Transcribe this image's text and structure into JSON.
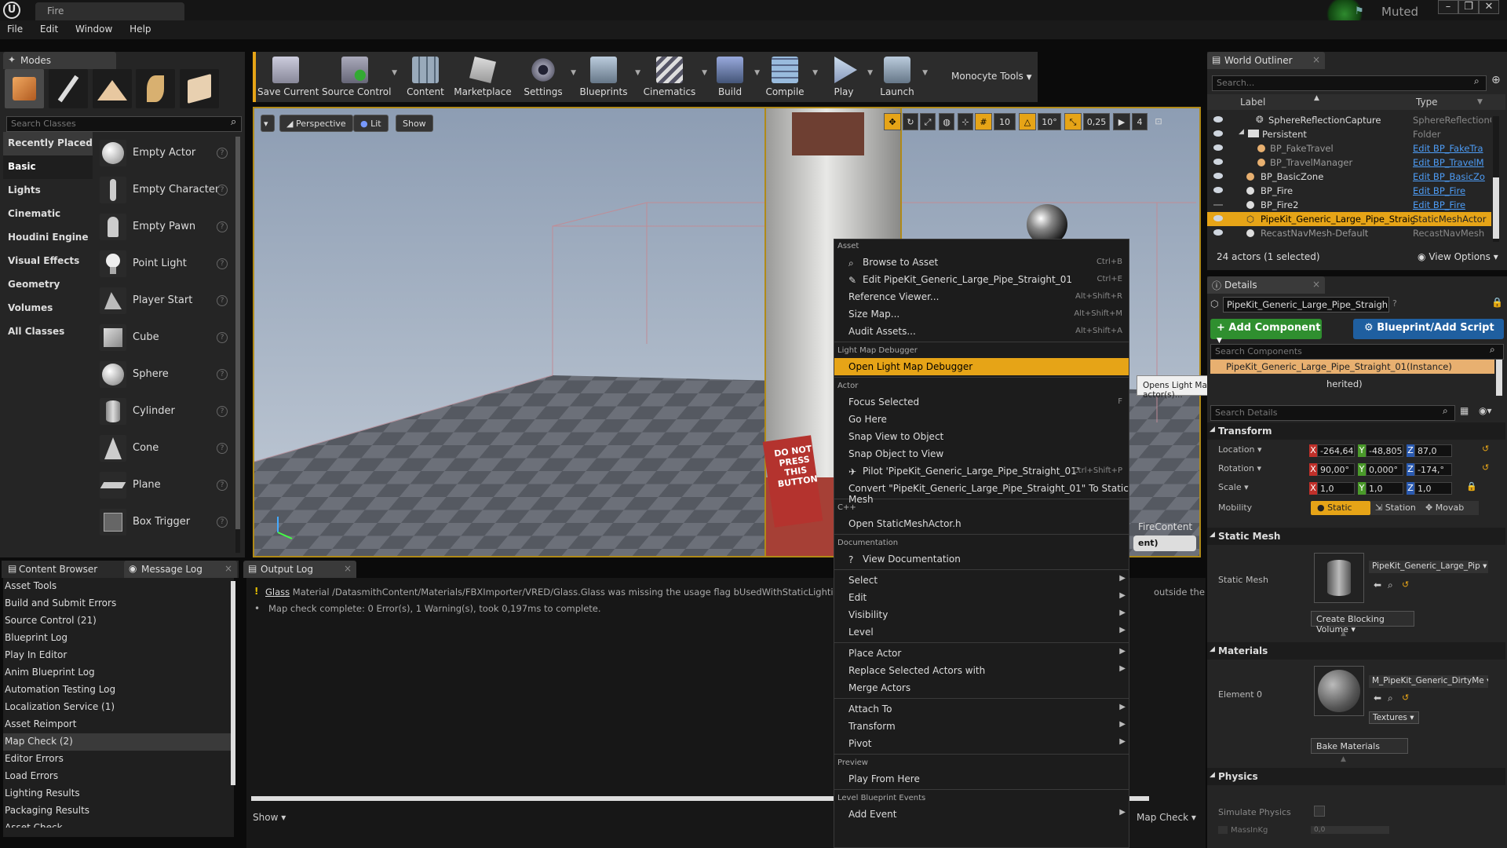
{
  "window": {
    "tab_title": "Fire",
    "muted_label": "Muted",
    "minimize": "–",
    "maximize": "❐",
    "close": "✕"
  },
  "menubar": [
    "File",
    "Edit",
    "Window",
    "Help"
  ],
  "modes": {
    "tab": "Modes",
    "search_placeholder": "Search Classes",
    "categories": [
      "Recently Placed",
      "Basic",
      "Lights",
      "Cinematic",
      "Houdini Engine",
      "Visual Effects",
      "Geometry",
      "Volumes",
      "All Classes"
    ],
    "items": [
      "Empty Actor",
      "Empty Character",
      "Empty Pawn",
      "Point Light",
      "Player Start",
      "Cube",
      "Sphere",
      "Cylinder",
      "Cone",
      "Plane",
      "Box Trigger"
    ]
  },
  "toolbar": {
    "buttons": [
      "Save Current",
      "Source Control",
      "Content",
      "Marketplace",
      "Settings",
      "Blueprints",
      "Cinematics",
      "Build",
      "Compile",
      "Play",
      "Launch"
    ],
    "monocyte": "Monocyte Tools"
  },
  "viewport": {
    "perspective": "Perspective",
    "lit": "Lit",
    "show": "Show",
    "grid_snap": "10",
    "rot_snap": "10°",
    "scale_snap": "0,25",
    "cam_speed": "4",
    "fire_content": "FireContent",
    "partial_btn": "ent)",
    "sign": "DO NOT PRESS THIS BUTTON"
  },
  "context_menu": {
    "asset_header": "Asset",
    "browse": "Browse to Asset",
    "browse_sc": "Ctrl+B",
    "edit": "Edit PipeKit_Generic_Large_Pipe_Straight_01",
    "edit_sc": "Ctrl+E",
    "ref_viewer": "Reference Viewer...",
    "ref_sc": "Alt+Shift+R",
    "size_map": "Size Map...",
    "size_sc": "Alt+Shift+M",
    "audit": "Audit Assets...",
    "audit_sc": "Alt+Shift+A",
    "lmd_header": "Light Map Debugger",
    "open_lmd": "Open Light Map Debugger",
    "actor_header": "Actor",
    "focus": "Focus Selected",
    "focus_sc": "F",
    "go_here": "Go Here",
    "snap_view": "Snap View to Object",
    "snap_obj": "Snap Object to View",
    "pilot": "Pilot 'PipeKit_Generic_Large_Pipe_Straight_01'",
    "pilot_sc": "Ctrl+Shift+P",
    "convert": "Convert \"PipeKit_Generic_Large_Pipe_Straight_01\" To Static Mesh",
    "cpp_header": "C++",
    "open_h": "Open StaticMeshActor.h",
    "doc_header": "Documentation",
    "view_doc": "View Documentation",
    "select": "Select",
    "edit2": "Edit",
    "visibility": "Visibility",
    "level": "Level",
    "place": "Place Actor",
    "replace": "Replace Selected Actors with",
    "merge": "Merge Actors",
    "attach": "Attach To",
    "transform": "Transform",
    "pivot": "Pivot",
    "preview_header": "Preview",
    "play_here": "Play From Here",
    "lbe_header": "Level Blueprint Events",
    "add_event": "Add Event"
  },
  "tooltip": "Opens Light Map Debugger(s) for the actor(s)...",
  "outliner": {
    "tab": "World Outliner",
    "search_placeholder": "Search...",
    "col_label": "Label",
    "col_type": "Type",
    "rows": [
      {
        "label": "SphereReflectionCapture",
        "type": "SphereReflectionC"
      },
      {
        "label": "Persistent",
        "type": "Folder"
      },
      {
        "label": "BP_FakeTravel",
        "type": "Edit BP_FakeTra"
      },
      {
        "label": "BP_TravelManager",
        "type": "Edit BP_TravelM"
      },
      {
        "label": "BP_BasicZone",
        "type": "Edit BP_BasicZo"
      },
      {
        "label": "BP_Fire",
        "type": "Edit BP_Fire"
      },
      {
        "label": "BP_Fire2",
        "type": "Edit BP_Fire"
      },
      {
        "label": "PipeKit_Generic_Large_Pipe_Straig",
        "type": "StaticMeshActor"
      },
      {
        "label": "RecastNavMesh-Default",
        "type": "RecastNavMesh"
      }
    ],
    "count": "24 actors (1 selected)",
    "view_options": "View Options"
  },
  "details": {
    "tab": "Details",
    "actor_name": "PipeKit_Generic_Large_Pipe_Straigh",
    "add_component": "+ Add Component",
    "blueprint": "Blueprint/Add Script",
    "search_comp": "Search Components",
    "instance": "PipeKit_Generic_Large_Pipe_Straight_01(Instance)",
    "inherited": "herited)",
    "search_details": "Search Details",
    "transform": "Transform",
    "location": "Location",
    "rotation": "Rotation",
    "scale": "Scale",
    "mobility": "Mobility",
    "loc": [
      "-264,64:",
      "-48,805•",
      "87,0"
    ],
    "rot": [
      "90,00°",
      "0,000°",
      "-174,°"
    ],
    "scl": [
      "1,0",
      "1,0",
      "1,0"
    ],
    "mob": [
      "Static",
      "Station",
      "Movab"
    ],
    "static_mesh_sec": "Static Mesh",
    "static_mesh_label": "Static Mesh",
    "mesh_name": "PipeKit_Generic_Large_Pip",
    "create_blocking": "Create Blocking Volume",
    "materials_sec": "Materials",
    "element0": "Element 0",
    "material_name": "M_PipeKit_Generic_DirtyMe",
    "textures": "Textures",
    "bake": "Bake Materials",
    "physics_sec": "Physics",
    "simulate": "Simulate Physics",
    "mass": "MassInKg",
    "mass_val": "0,0"
  },
  "bottom": {
    "tabs": [
      "Content Browser",
      "Message Log",
      "Output Log"
    ],
    "log_items": [
      "Asset Tools",
      "Build and Submit Errors",
      "Source Control (21)",
      "Blueprint Log",
      "Play In Editor",
      "Anim Blueprint Log",
      "Automation Testing Log",
      "Localization Service (1)",
      "Asset Reimport",
      "Map Check (2)",
      "Editor Errors",
      "Load Errors",
      "Lighting Results",
      "Packaging Results",
      "Asset Check"
    ],
    "msg1_link": "Glass",
    "msg1": "Material /DatasmithContent/Materials/FBXImporter/VRED/Glass.Glass was missing the usage flag bUsedWithStaticLighting. I",
    "msg1_tail": "outside the e",
    "msg2": "Map check complete: 0 Error(s), 1 Warning(s), took 0,197ms to complete.",
    "show": "Show",
    "map_check": "Map Check"
  },
  "colors": {
    "accent": "#e6a417",
    "link": "#4d9cf5",
    "selection": "#e6a417",
    "add_green": "#2f8f2f",
    "blueprint_blue": "#1f5fa0"
  }
}
